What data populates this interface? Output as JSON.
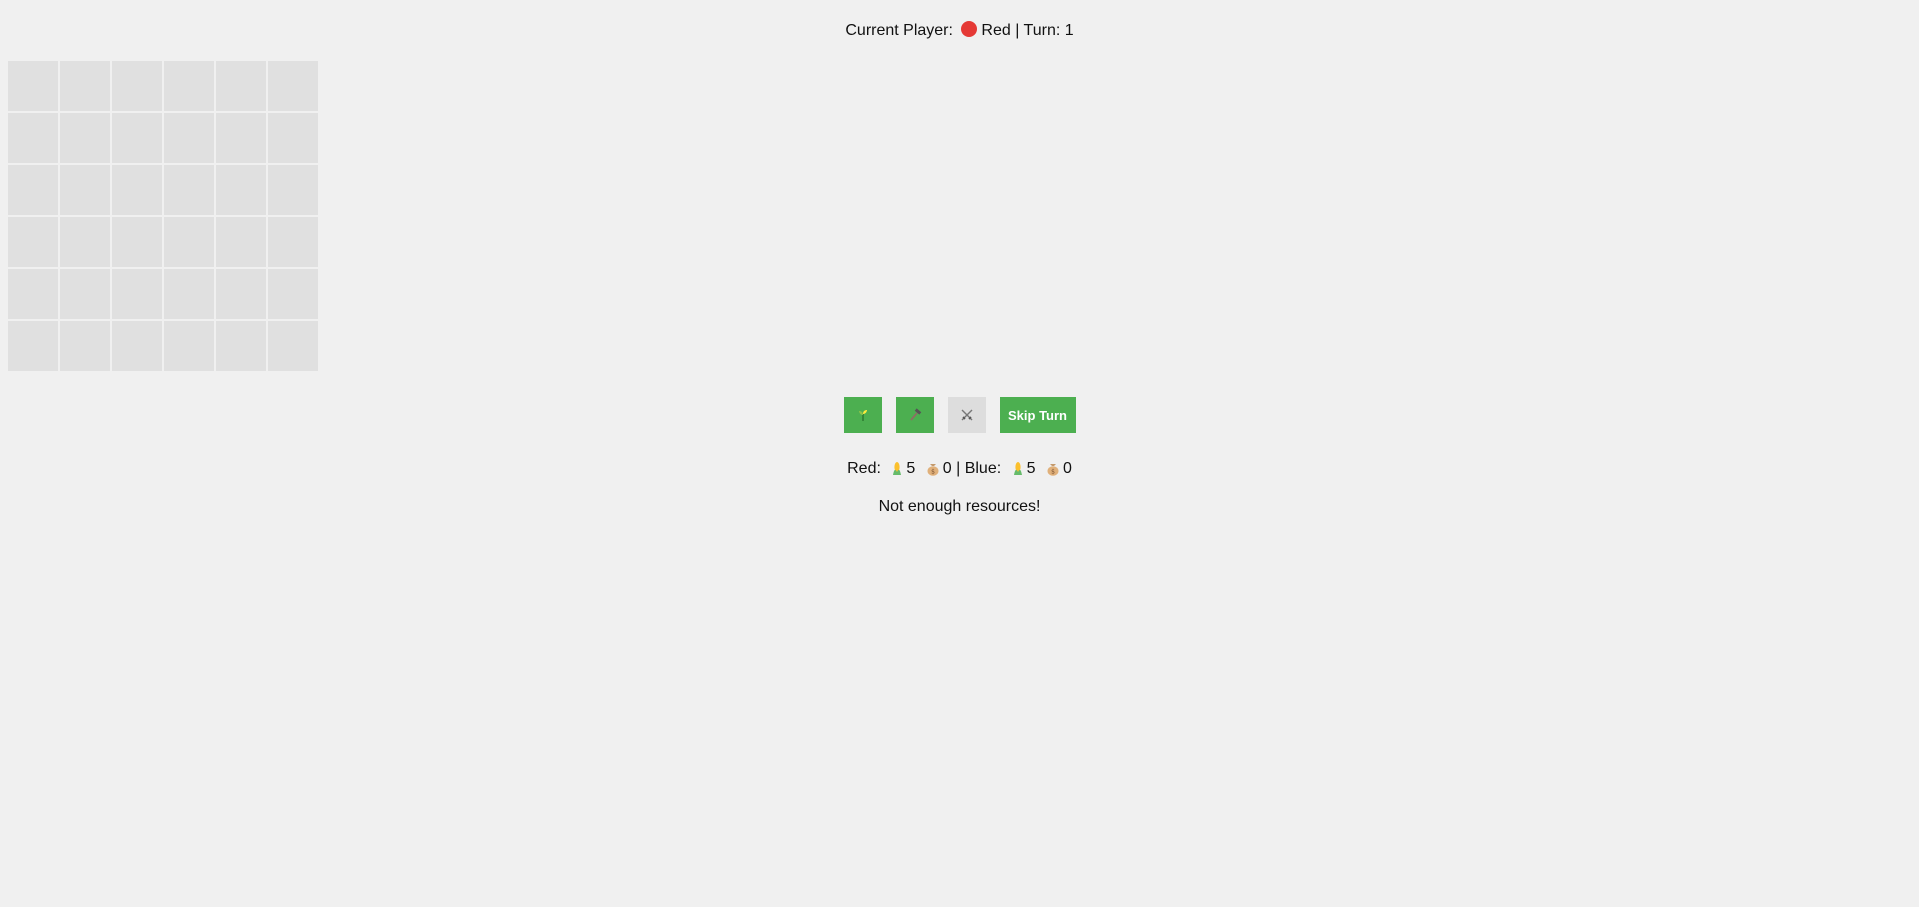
{
  "status": {
    "prefix": "Current Player:",
    "player_name": "Red",
    "player_color": "#e53935",
    "separator": "|",
    "turn_label": "Turn:",
    "turn_number": "1"
  },
  "board": {
    "rows": 6,
    "cols": 6,
    "cell_color": "#e0e0e0"
  },
  "actions": {
    "farm": {
      "icon": "sprout-icon",
      "color": "#4caf50",
      "enabled": true
    },
    "build": {
      "icon": "hammer-icon",
      "color": "#4caf50",
      "enabled": true
    },
    "attack": {
      "icon": "crossed-swords-icon",
      "color": "#dddddd",
      "enabled": false
    },
    "skip_label": "Skip Turn"
  },
  "resources": {
    "red_label": "Red:",
    "red_food": "5",
    "red_gold": "0",
    "separator": "|",
    "blue_label": "Blue:",
    "blue_food": "5",
    "blue_gold": "0",
    "food_icon": "corn-icon",
    "gold_icon": "money-bag-icon"
  },
  "message": "Not enough resources!"
}
